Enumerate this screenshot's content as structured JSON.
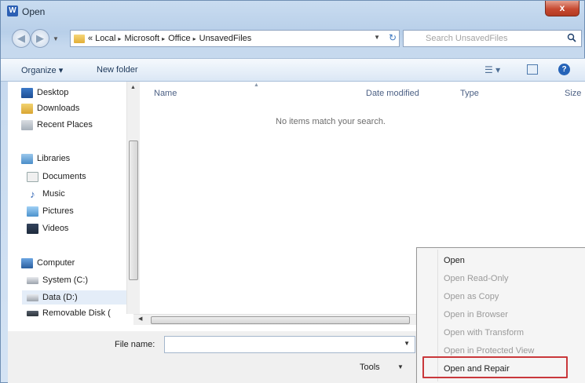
{
  "window": {
    "title": "Open",
    "app_icon": "W",
    "close_label": "x"
  },
  "address": {
    "prefix": "«",
    "crumbs": [
      "Local",
      "Microsoft",
      "Office",
      "UnsavedFiles"
    ],
    "separator": "▸"
  },
  "search": {
    "placeholder": "Search UnsavedFiles"
  },
  "toolbar": {
    "organize_label": "Organize ▾",
    "new_folder_label": "New folder",
    "views_label": "☰ ▾"
  },
  "nav": {
    "items": [
      {
        "label": "Desktop",
        "icon": "desktop-icon"
      },
      {
        "label": "Downloads",
        "icon": "downloads-icon"
      },
      {
        "label": "Recent Places",
        "icon": "recent-places-icon"
      },
      {
        "label": "Libraries",
        "icon": "libraries-icon"
      },
      {
        "label": "Documents",
        "icon": "documents-icon"
      },
      {
        "label": "Music",
        "icon": "music-icon"
      },
      {
        "label": "Pictures",
        "icon": "pictures-icon"
      },
      {
        "label": "Videos",
        "icon": "videos-icon"
      },
      {
        "label": "Computer",
        "icon": "computer-icon"
      },
      {
        "label": "System (C:)",
        "icon": "drive-icon"
      },
      {
        "label": "Data (D:)",
        "icon": "drive-icon"
      },
      {
        "label": "Removable Disk (",
        "icon": "removable-disk-icon"
      }
    ]
  },
  "columns": {
    "name": "Name",
    "date_modified": "Date modified",
    "type": "Type",
    "size": "Size"
  },
  "empty_message": "No items match your search.",
  "bottom": {
    "file_name_label": "File name:",
    "file_name_value": "",
    "tools_label": "Tools"
  },
  "menu": {
    "items": [
      {
        "label": "Open",
        "enabled": true
      },
      {
        "label": "Open Read-Only",
        "enabled": false
      },
      {
        "label": "Open as Copy",
        "enabled": false
      },
      {
        "label": "Open in Browser",
        "enabled": false
      },
      {
        "label": "Open with Transform",
        "enabled": false
      },
      {
        "label": "Open in Protected View",
        "enabled": false
      },
      {
        "label": "Open and Repair",
        "enabled": true,
        "highlighted": true
      }
    ]
  },
  "colors": {
    "highlight_border": "#c9383b",
    "help_icon": "#2563b8"
  }
}
